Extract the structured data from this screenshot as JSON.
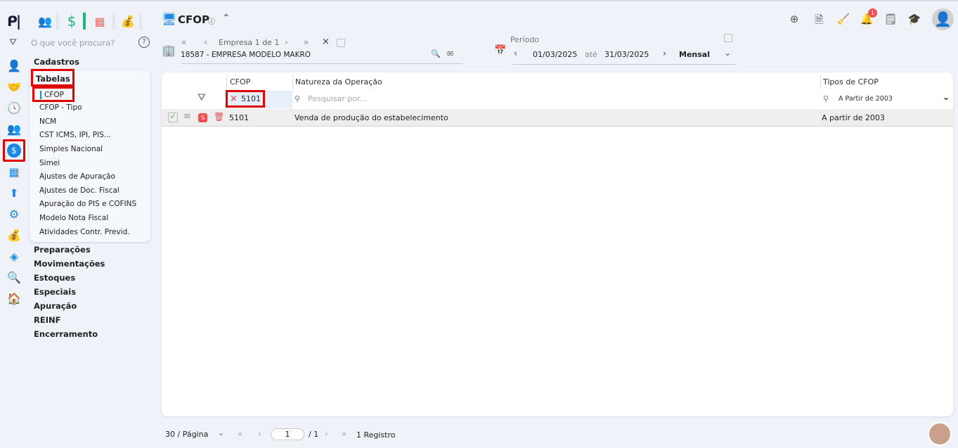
{
  "app": {
    "title": "CFOP",
    "search_placeholder": "O que você procura?"
  },
  "company": {
    "nav_label": "Empresa 1 de 1",
    "name": "18587 - EMPRESA MODELO MAKRO"
  },
  "period": {
    "label": "Período",
    "start": "01/03/2025",
    "sep": "até",
    "end": "31/03/2025",
    "mode": "Mensal"
  },
  "menu": {
    "sections": [
      "Cadastros",
      "Preparações",
      "Movimentações",
      "Estoques",
      "Especiais",
      "Apuração",
      "REINF",
      "Encerramento"
    ],
    "group": "Tabelas",
    "items": [
      "CFOP",
      "CFOP - Tipo",
      "NCM",
      "CST ICMS, IPI, PIS...",
      "Simples Nacional",
      "Simei",
      "Ajustes de Apuração",
      "Ajustes de Doc. Fiscal",
      "Apuração do PIS e COFINS",
      "Modelo Nota Fiscal",
      "Atividades Contr. Previd."
    ]
  },
  "notifications": {
    "count": "1"
  },
  "table": {
    "columns": [
      "CFOP",
      "Natureza da Operação",
      "Tipos de CFOP"
    ],
    "filters": {
      "cfop": "5101",
      "natureza_placeholder": "Pesquisar por...",
      "tipo": "A Partir de 2003"
    },
    "rows": [
      {
        "badge": "S",
        "cfop": "5101",
        "natureza": "Venda de produção do estabelecimento",
        "tipo": "A partir de 2003"
      }
    ]
  },
  "pagination": {
    "per_page": "30 / Página",
    "page": "1",
    "total_pages": "/ 1",
    "records": "1 Registro"
  },
  "colors": {
    "accent": "#1e88e5",
    "highlight": "#e00000",
    "green": "#1bb580"
  }
}
